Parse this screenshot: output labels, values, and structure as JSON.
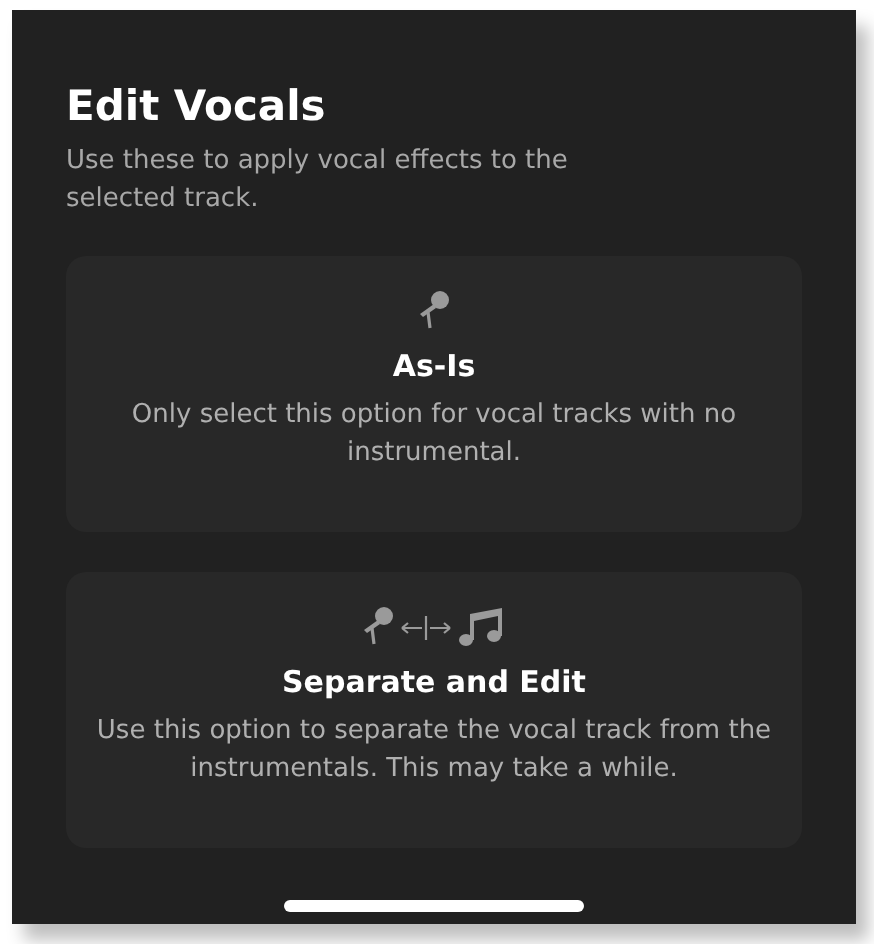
{
  "sheet": {
    "title": "Edit Vocals",
    "subtitle": "Use these to apply vocal effects to the selected track."
  },
  "options": [
    {
      "kind": "keep",
      "title": "As-Is",
      "description": "Only select this option for vocal tracks with no instrumental."
    },
    {
      "kind": "separate",
      "title": "Separate and Edit",
      "description": "Use this option to separate the vocal track from the instrumentals. This may take a while."
    }
  ]
}
